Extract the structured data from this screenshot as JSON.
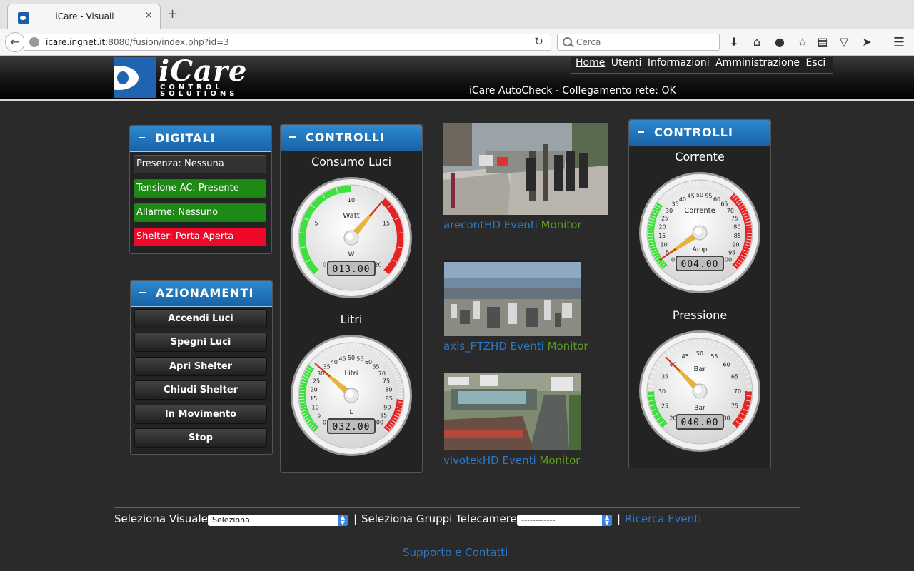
{
  "browser": {
    "tab_title": "iCare - Visuali",
    "close_glyph": "✕",
    "newtab_glyph": "+",
    "url_host": "icare.ingnet.it",
    "url_rest": ":8080/fusion/index.php?id=3",
    "search_placeholder": "Cerca",
    "icons": [
      "download-icon",
      "home-icon",
      "chat-icon",
      "bookmark-star-icon",
      "reading-list-icon",
      "pocket-icon",
      "send-icon",
      "menu-icon"
    ]
  },
  "header": {
    "logo_main": "iCare",
    "logo_sub1": "CONTROL",
    "logo_sub2": "SOLUTIONS",
    "menu": [
      "Home",
      "Utenti",
      "Informazioni",
      "Amministrazione",
      "Esci"
    ],
    "autocheck": "iCare AutoCheck - Collegamento rete: OK"
  },
  "digitali": {
    "title": "DIGITALI",
    "items": [
      {
        "label": "Presenza: Nessuna",
        "state": "grey"
      },
      {
        "label": "Tensione AC: Presente",
        "state": "green"
      },
      {
        "label": "Allarme: Nessuno",
        "state": "green"
      },
      {
        "label": "Shelter: Porta Aperta",
        "state": "red"
      }
    ]
  },
  "azionamenti": {
    "title": "AZIONAMENTI",
    "buttons": [
      "Accendi Luci",
      "Spegni Luci",
      "Apri Shelter",
      "Chiudi Shelter",
      "In Movimento",
      "Stop"
    ]
  },
  "controlli_left": {
    "title": "CONTROLLI",
    "gauges": [
      {
        "title": "Consumo Luci",
        "label": "Watt",
        "unit": "W",
        "min": 0,
        "max": 20,
        "ticks": [
          0,
          5,
          10,
          15,
          20
        ],
        "value": 13,
        "readout": "013.00",
        "green": [
          0,
          10
        ],
        "red": [
          13,
          20
        ]
      },
      {
        "title": "Litri",
        "label": "Litri",
        "unit": "L",
        "min": 0,
        "max": 100,
        "ticks": [
          0,
          5,
          10,
          15,
          20,
          25,
          30,
          35,
          40,
          45,
          50,
          55,
          60,
          65,
          70,
          75,
          80,
          85,
          90,
          95,
          100
        ],
        "value": 32,
        "readout": "032.00",
        "green": [
          0,
          30
        ],
        "red": [
          85,
          100
        ]
      }
    ]
  },
  "controlli_right": {
    "title": "CONTROLLI",
    "gauges": [
      {
        "title": "Corrente",
        "label": "Corrente",
        "unit": "Amp",
        "min": 0,
        "max": 100,
        "ticks": [
          0,
          5,
          10,
          15,
          20,
          25,
          30,
          35,
          40,
          45,
          50,
          55,
          60,
          65,
          70,
          75,
          80,
          85,
          90,
          95,
          100
        ],
        "value": 4,
        "readout": "004.00",
        "green": [
          0,
          30
        ],
        "red": [
          65,
          100
        ]
      },
      {
        "title": "Pressione",
        "label": "Bar",
        "unit": "Bar",
        "min": 20,
        "max": 80,
        "ticks": [
          20,
          25,
          30,
          35,
          40,
          45,
          50,
          55,
          60,
          65,
          70,
          75,
          80
        ],
        "value": 40,
        "readout": "040.00",
        "green": [
          20,
          30
        ],
        "red": [
          70,
          80
        ]
      }
    ]
  },
  "cameras": [
    {
      "name": "arecontHD Eventi",
      "monitor": "Monitor"
    },
    {
      "name": "axis_PTZHD Eventi",
      "monitor": "Monitor"
    },
    {
      "name": "vivotekHD Eventi",
      "monitor": "Monitor"
    }
  ],
  "footer": {
    "sel_visuale_label": "Seleziona Visuale:",
    "sel_visuale_value": "Seleziona",
    "sep": "|",
    "sel_gruppi_label": "Seleziona Gruppi Telecamere:",
    "sel_gruppi_value": "------------",
    "ricerca": "Ricerca Eventi",
    "supporto": "Supporto e Contatti"
  }
}
